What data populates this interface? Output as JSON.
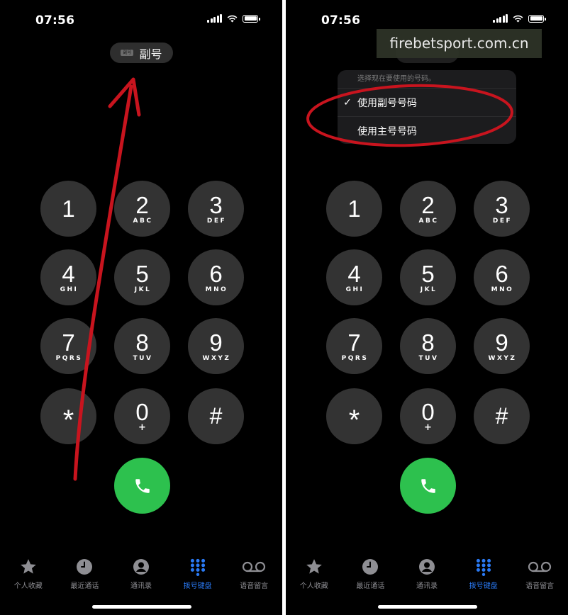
{
  "colors": {
    "background": "#000000",
    "key": "#333333",
    "call": "#2dc14e",
    "accent": "#2a7af5",
    "annotation": "#c8141e"
  },
  "status": {
    "time": "07:56",
    "icons": [
      "cellular-signal-icon",
      "wifi-icon",
      "battery-icon"
    ]
  },
  "line_selector": {
    "badge": "副号",
    "label": "副号"
  },
  "keypad": [
    {
      "digit": "1",
      "letters": ""
    },
    {
      "digit": "2",
      "letters": "ABC"
    },
    {
      "digit": "3",
      "letters": "DEF"
    },
    {
      "digit": "4",
      "letters": "GHI"
    },
    {
      "digit": "5",
      "letters": "JKL"
    },
    {
      "digit": "6",
      "letters": "MNO"
    },
    {
      "digit": "7",
      "letters": "PQRS"
    },
    {
      "digit": "8",
      "letters": "TUV"
    },
    {
      "digit": "9",
      "letters": "WXYZ"
    },
    {
      "digit": "*",
      "letters": ""
    },
    {
      "digit": "0",
      "letters": "+"
    },
    {
      "digit": "#",
      "letters": ""
    }
  ],
  "call_button": {
    "icon": "phone-icon"
  },
  "tabs": [
    {
      "label": "个人收藏",
      "icon": "star-icon",
      "active": false
    },
    {
      "label": "最近通话",
      "icon": "clock-icon",
      "active": false
    },
    {
      "label": "通讯录",
      "icon": "person-icon",
      "active": false
    },
    {
      "label": "拨号键盘",
      "icon": "keypad-icon",
      "active": true
    },
    {
      "label": "语音留言",
      "icon": "voicemail-icon",
      "active": false
    }
  ],
  "line_menu": {
    "header": "选择现在要使用的号码。",
    "options": [
      {
        "label": "使用副号号码",
        "checked": true
      },
      {
        "label": "使用主号号码",
        "checked": false
      }
    ]
  },
  "watermark": "firebetsport.com.cn"
}
